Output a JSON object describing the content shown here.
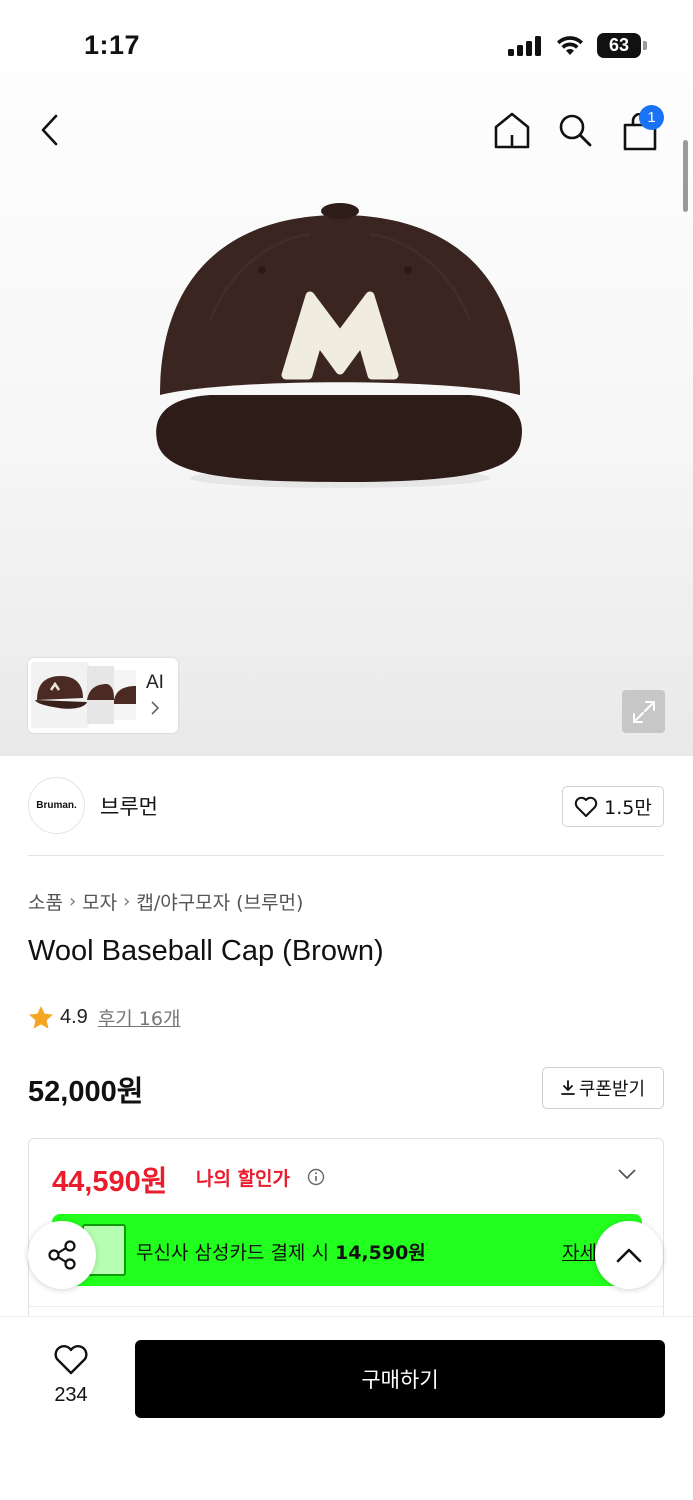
{
  "status": {
    "time": "1:17",
    "battery": "63"
  },
  "nav": {
    "cart_count": "1"
  },
  "thumbnails": {
    "ai_label": "AI"
  },
  "brand": {
    "logo_text": "Bruman.",
    "name": "브루먼",
    "like_count": "1.5만"
  },
  "breadcrumb": [
    "소품",
    "모자",
    "캡/야구모자 (브루먼)"
  ],
  "product": {
    "title": "Wool Baseball Cap (Brown)",
    "rating": "4.9",
    "review_label": "후기 16개",
    "price": "52,000원",
    "coupon_label": "쿠폰받기",
    "image_logo_letter": "M",
    "image_colors": {
      "cap": "#3a2521",
      "patch": "#f1ece0"
    }
  },
  "discount": {
    "price": "44,590원",
    "label": "나의 할인가"
  },
  "card_banner": {
    "text_prefix": "무신사 삼성카드 결제 시 ",
    "text_amount": "14,590원",
    "detail": "자세",
    "color": "#22ff1e"
  },
  "bottom": {
    "wish_count": "234",
    "buy_label": "구매하기"
  },
  "colors": {
    "accent_red": "#ea1d2c",
    "badge_blue": "#1a73f5"
  }
}
